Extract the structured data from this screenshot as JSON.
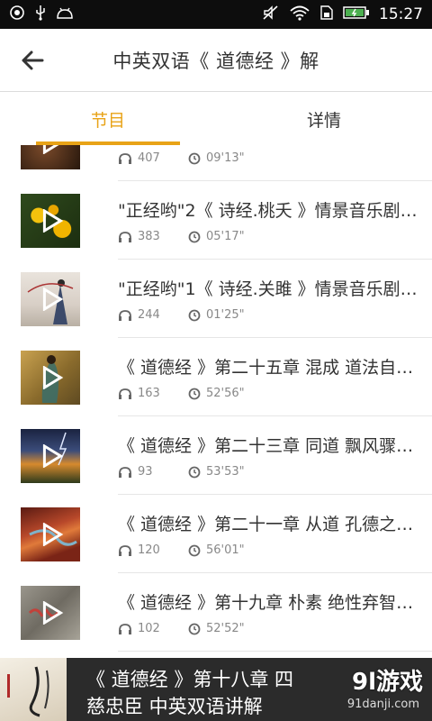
{
  "status_bar": {
    "time": "15:27",
    "icons": [
      "notification-icon",
      "usb-icon",
      "android-icon",
      "mute-icon",
      "wifi-icon",
      "sim-icon",
      "battery-icon"
    ]
  },
  "header": {
    "title": "中英双语《 道德经 》解",
    "back_icon": "arrow-left-icon"
  },
  "tabs": [
    {
      "label": "节目",
      "active": true
    },
    {
      "label": "详情",
      "active": false
    }
  ],
  "colors": {
    "accent": "#e8a317",
    "text": "#333333",
    "meta": "#888888"
  },
  "episodes": [
    {
      "title": "",
      "plays": "407",
      "duration": "09'13\""
    },
    {
      "title": "\"正经哟\"2《 诗经.桃夭 》情景音乐剧…",
      "plays": "383",
      "duration": "05'17\""
    },
    {
      "title": "\"正经哟\"1《 诗经.关雎 》情景音乐剧…",
      "plays": "244",
      "duration": "01'25\""
    },
    {
      "title": "《 道德经 》第二十五章 混成 道法自…",
      "plays": "163",
      "duration": "52'56\""
    },
    {
      "title": "《 道德经 》第二十三章 同道 飘风骤…",
      "plays": "93",
      "duration": "53'53\""
    },
    {
      "title": "《 道德经 》第二十一章 从道 孔德之…",
      "plays": "120",
      "duration": "56'01\""
    },
    {
      "title": "《 道德经 》第十九章 朴素 绝性弃智…",
      "plays": "102",
      "duration": "52'52\""
    }
  ],
  "banner": {
    "line1": "《 道德经 》第十八章 四",
    "line2": "慈忠臣 中英双语讲解",
    "watermark": "9l游戏",
    "watermark_url": "91danji.com"
  }
}
